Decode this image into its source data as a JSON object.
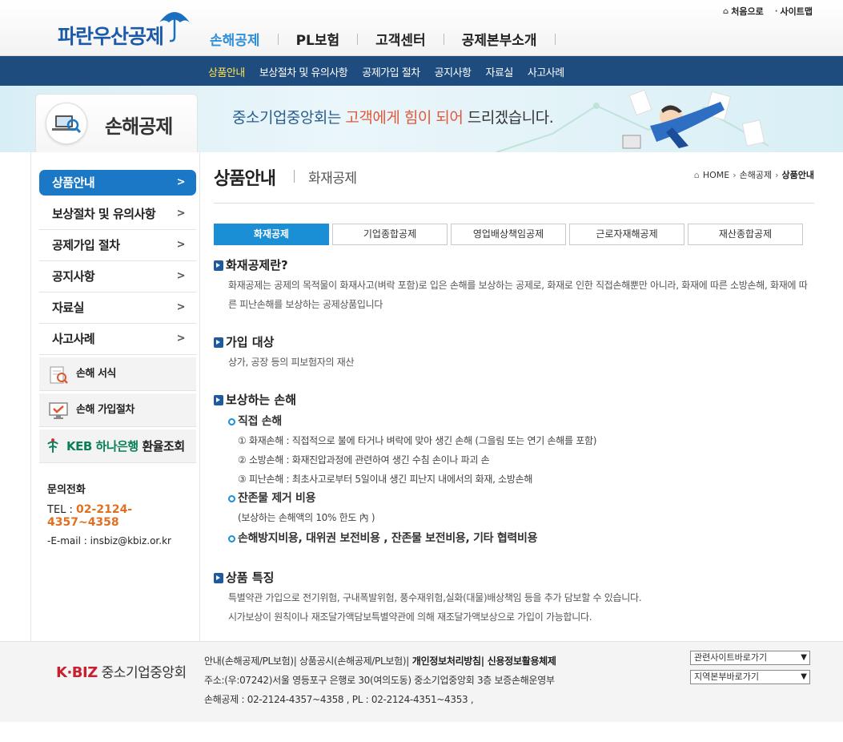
{
  "header": {
    "logo_text": "파란우산공제",
    "gnb": [
      "손해공제",
      "PL보험",
      "고객센터",
      "공제본부소개"
    ],
    "util": [
      "처음으로",
      "사이트맵"
    ]
  },
  "subnav": [
    "상품안내",
    "보상절차 및 유의사항",
    "공제가입 절차",
    "공지사항",
    "자료실",
    "사고사례"
  ],
  "banner": {
    "section_title": "손해공제",
    "slogan_a": "중소기업중앙회는 ",
    "slogan_b": "고객에게 힘이 되어",
    "slogan_c": " 드리겠습니다."
  },
  "lnb": {
    "items": [
      "상품안내",
      "보상절차 및 유의사항",
      "공제가입 절차",
      "공지사항",
      "자료실",
      "사고사례"
    ],
    "arrow": ">",
    "quick": [
      "손해 서식",
      "손해 가입절차"
    ],
    "keb_logo": "KEB 하나은행",
    "keb_label": " 환율조회",
    "contact_title": "문의전화",
    "tel_label": "TEL : ",
    "tel_number": "02-2124-4357~4358",
    "email": "-E-mail : insbiz@kbiz.or.kr"
  },
  "content": {
    "title": "상품안내",
    "subtitle": "화재공제",
    "breadcrumb": [
      "HOME",
      "손해공제",
      "상품안내"
    ],
    "tabs": [
      "화재공제",
      "기업종합공제",
      "영업배상책임공제",
      "근로자재해공제",
      "재산종합공제"
    ],
    "sec1_title": "화재공제란?",
    "sec1_text": "화재공제는 공제의 목적물이 화재사고(벼락 포함)로 입은 손해를 보상하는 공제로, 화재로 인한 직접손해뿐만 아니라, 화재에 따른 소방손해, 화재에 따른 피난손해를 보상하는 공제상품입니다",
    "sec2_title": "가입 대상",
    "sec2_text": "상가, 공장 등의 피보험자의 재산",
    "sec3_title": "보상하는 손해",
    "sub1_title": "직접 손해",
    "sub1_items": [
      "① 화재손해 : 직접적으로 불에 타거나 벼락에 맞아 생긴 손해 (그을림 또는 연기 손해를 포함)",
      "② 소방손해 : 화재진압과정에 관련하여 생긴 수침 손이나 파괴 손",
      "③ 피난손해 : 최초사고로부터 5일이내 생긴 피난지 내에서의 화재, 소방손해"
    ],
    "sub2_title": "잔존물 제거 비용",
    "sub2_text": "(보상하는 손해액의 10% 한도 內 )",
    "sub3_title": "손해방지비용, 대위권 보전비용 , 잔존물 보전비용, 기타 협력비용",
    "sec4_title": "상품 특징",
    "sec4_lines": [
      "특별약관 가입으로 전기위험, 구내폭발위험, 풍수재위험,실화(대물)배상책임 등을 추가 담보할 수 있습니다.",
      "시가보상이 원칙이나 재조달가액담보특별약관에 의해 재조달가액보상으로 가입이 가능합니다."
    ]
  },
  "footer": {
    "logo_a": "K·BIZ",
    "logo_b": " 중소기업중앙회",
    "links": "안내(손해공제/PL보험)| 상품공시(손해공제/PL보험)|",
    "links_bold": " 개인정보처리방침| 신용정보활용체제",
    "address": "주소:(우:07242)서울 영등포구 은행로 30(여의도동) 중소기업중앙회 3층 보증손해운영부",
    "phones": "손해공제 : 02-2124-4357~4358 , PL : 02-2124-4351~4353 ,",
    "select1": "관련사이트바로가기",
    "select2": "지역본부바로가기"
  },
  "colors": {
    "primary": "#1f4c7e",
    "accent": "#1b8fd6",
    "highlight": "#e2583a",
    "tel": "#e07020"
  }
}
